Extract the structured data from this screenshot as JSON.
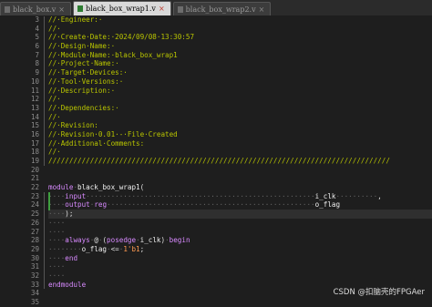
{
  "tabs": [
    {
      "label": "black_box.v",
      "close": "×",
      "active": false
    },
    {
      "label": "black_box_wrap1.v",
      "close": "×",
      "active": true
    },
    {
      "label": "black_box_wrap2.v",
      "close": "×",
      "active": false
    }
  ],
  "line_numbers": [
    "3",
    "4",
    "5",
    "6",
    "7",
    "8",
    "9",
    "10",
    "11",
    "12",
    "13",
    "14",
    "15",
    "16",
    "17",
    "18",
    "19",
    "20",
    "21",
    "22",
    "23",
    "24",
    "25",
    "26",
    "27",
    "28",
    "29",
    "30",
    "31",
    "32",
    "33",
    "34",
    "35"
  ],
  "code_lines": [
    "//·Engineer:·",
    "//·",
    "//·Create·Date:·2024/09/08·13:30:57",
    "//·Design·Name:·",
    "//·Module·Name:·black_box_wrap1",
    "//·Project·Name:·",
    "//·Target·Devices:·",
    "//·Tool·Versions:·",
    "//·Description:·",
    "//·",
    "//·Dependencies:·",
    "//·",
    "//·Revision:",
    "//·Revision·0.01·-·File·Created",
    "//·Additional·Comments:",
    "//·",
    "//////////////////////////////////////////////////////////////////////////////////",
    "",
    "",
    "module·black_box_wrap1(",
    "····input·······················································i_clk··········,",
    "····output·reg··················································o_flag",
    "····);",
    "····",
    "····",
    "····always·@·(posedge·i_clk)·begin",
    "········o_flag·<=·1'b1;",
    "····end",
    "····",
    "····",
    "endmodule",
    "",
    ""
  ],
  "watermark": "CSDN @扣脑壳的FPGAer"
}
